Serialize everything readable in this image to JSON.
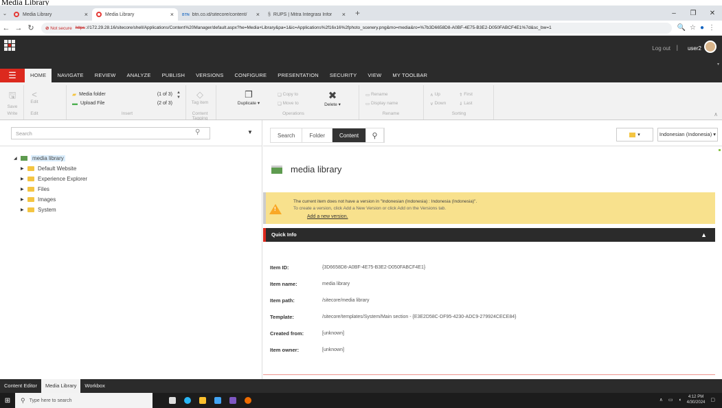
{
  "page_caption": "Media Library",
  "browser": {
    "tabs": [
      {
        "label": "Media Library",
        "active": false
      },
      {
        "label": "Media Library",
        "active": true
      },
      {
        "label": "btn.co.id/sitecore/content/BTN",
        "active": false
      },
      {
        "label": "RUPS | Mitra Integrasi Informat",
        "active": false
      }
    ],
    "not_secure": "Not secure",
    "url_scheme": "https",
    "url_rest": "://172.29.28.16/sitecore/shell/Applications/Content%20Manager/default.aspx?he=Media+Library&pa=1&ic=Applications%2f16x16%2fphoto_scenery.png&mo=media&ro=%7b3D6658D8-A0BF-4E75-B3E2-D050FABCF4E1%7d&sc_bw=1"
  },
  "app": {
    "logout": "Log out",
    "separator": "|",
    "user": "user2"
  },
  "ribbon_tabs": [
    "HOME",
    "NAVIGATE",
    "REVIEW",
    "ANALYZE",
    "PUBLISH",
    "VERSIONS",
    "CONFIGURE",
    "PRESENTATION",
    "SECURITY",
    "VIEW",
    "MY TOOLBAR"
  ],
  "ribbon": {
    "save": "Save",
    "edit": "Edit",
    "write_group": "Write",
    "edit_group": "Edit",
    "insert_items": [
      {
        "label": "Media folder",
        "count": "(1 of 3)"
      },
      {
        "label": "Upload File",
        "count": "(2 of 3)"
      }
    ],
    "insert_group": "Insert",
    "tag_item": "Tag item",
    "content_tagging_group": "Content Tagging",
    "duplicate": "Duplicate",
    "copy_to": "Copy to",
    "move_to": "Move to",
    "delete": "Delete",
    "operations_group": "Operations",
    "rename": "Rename",
    "display_name": "Display name",
    "rename_group": "Rename",
    "up": "Up",
    "down": "Down",
    "first": "First",
    "last": "Last",
    "sorting_group": "Sorting"
  },
  "left": {
    "search_placeholder": "Search",
    "tree_root": "media library",
    "tree_children": [
      "Default Website",
      "Experience Explorer",
      "Files",
      "Images",
      "System"
    ]
  },
  "right": {
    "tabs": [
      "Search",
      "Folder",
      "Content"
    ],
    "language": "Indonesian (Indonesia)",
    "item_title": "media library",
    "warning_title": "The current item does not have a version in \"Indonesian (Indonesia) : Indonesia (Indonesia)\".",
    "warning_text": "To create a version, click Add a New Version or click Add on the Versions tab.",
    "warning_link": "Add a new version.",
    "quick_info": "Quick Info",
    "fields": [
      {
        "label": "Item ID:",
        "value": "{3D6658D8-A0BF-4E75-B3E2-D050FABCF4E1}"
      },
      {
        "label": "Item name:",
        "value": "media library"
      },
      {
        "label": "Item path:",
        "value": "/sitecore/media library"
      },
      {
        "label": "Template:",
        "value": "/sitecore/templates/System/Main section - {E3E2D58C-DF95-4230-ADC9-279924CECE84}"
      },
      {
        "label": "Created from:",
        "value": "[unknown]"
      },
      {
        "label": "Item owner:",
        "value": "[unknown]"
      }
    ]
  },
  "bottom_tabs": [
    "Content Editor",
    "Media Library",
    "Workbox"
  ],
  "taskbar": {
    "search_placeholder": "Type here to search",
    "time": "4:12 PM",
    "date": "4/30/2024"
  },
  "colors": {
    "accent": "#dc291e",
    "dark": "#2b2b2b",
    "warning_bg": "#f8e18d"
  }
}
